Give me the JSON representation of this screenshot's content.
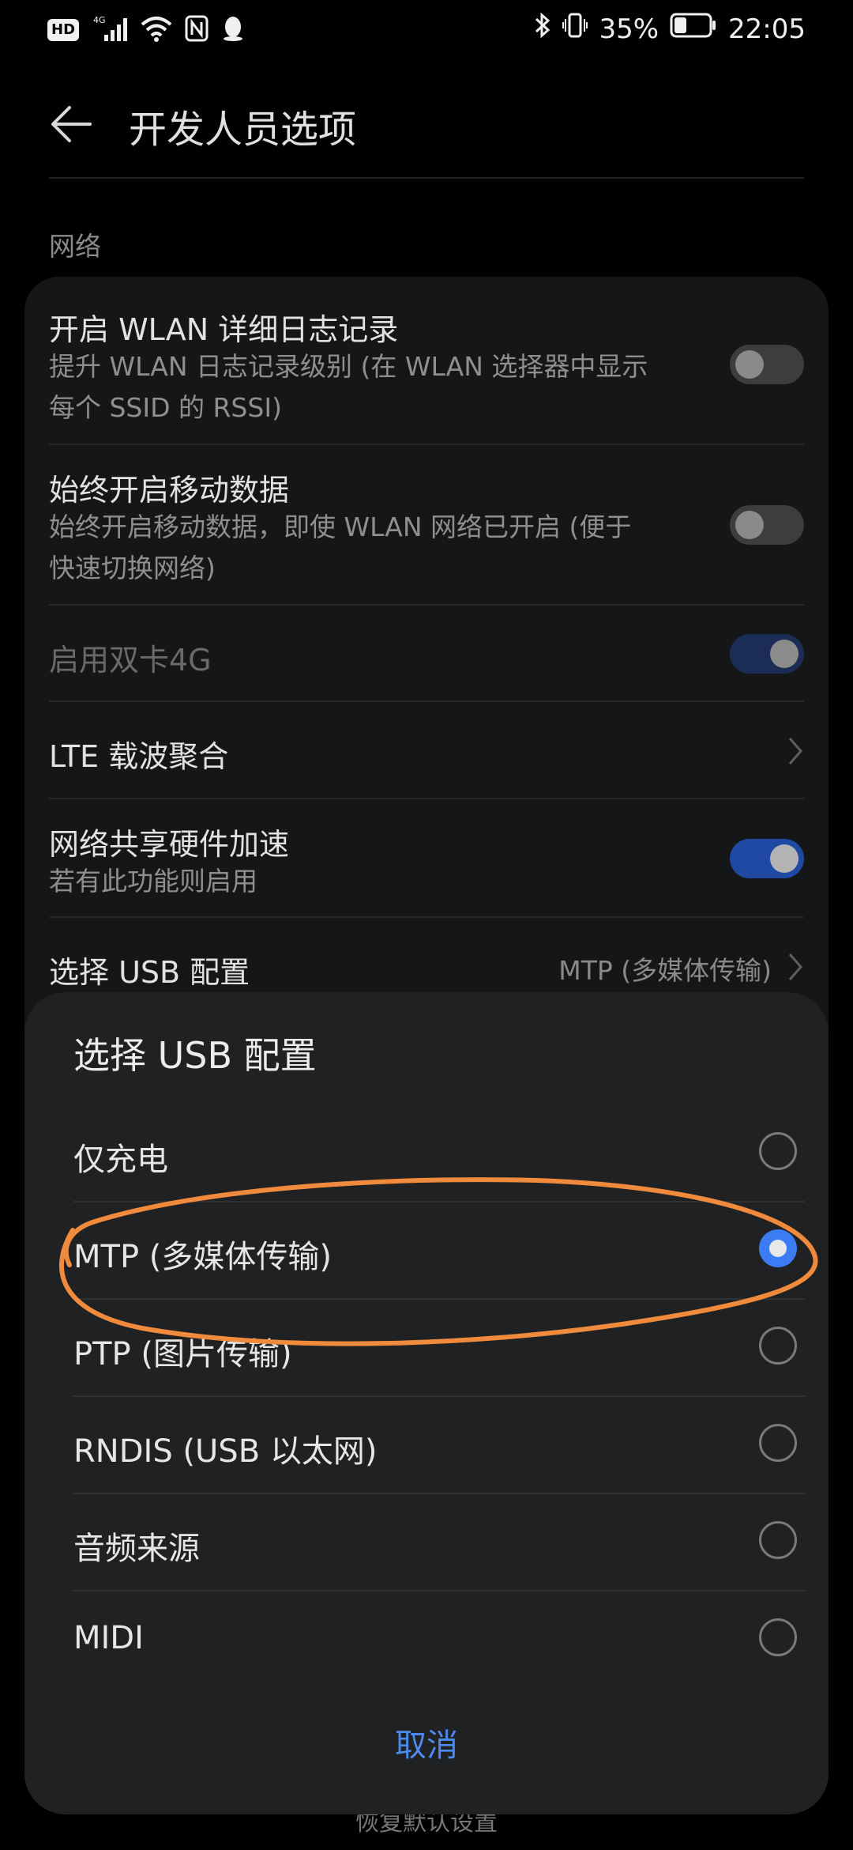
{
  "status_bar": {
    "hd_label": "HD",
    "network_label": "4G",
    "battery_percent": "35%",
    "time": "22:05",
    "icons": [
      "hd-icon",
      "signal-icon",
      "wifi-icon",
      "nfc-icon",
      "qq-icon",
      "bluetooth-icon",
      "vibrate-icon",
      "battery-icon"
    ],
    "battery_level": 0.35
  },
  "header": {
    "title": "开发人员选项",
    "back_icon": "arrow-left-icon"
  },
  "section": {
    "label": "网络"
  },
  "settings": [
    {
      "title": "开启 WLAN 详细日志记录",
      "subtitle_line1": "提升 WLAN 日志记录级别 (在 WLAN 选择器中显示",
      "subtitle_line2": "每个 SSID 的 RSSI)",
      "control": "toggle",
      "on": false
    },
    {
      "title": "始终开启移动数据",
      "subtitle_line1": "始终开启移动数据，即使 WLAN 网络已开启 (便于",
      "subtitle_line2": "快速切换网络)",
      "control": "toggle",
      "on": false
    },
    {
      "title": "启用双卡4G",
      "control": "toggle",
      "on": true,
      "disabled": true
    },
    {
      "title": "LTE 载波聚合",
      "control": "chevron"
    },
    {
      "title": "网络共享硬件加速",
      "subtitle_line1": "若有此功能则启用",
      "control": "toggle",
      "on": true
    },
    {
      "title": "选择 USB 配置",
      "value": "MTP (多媒体传输)",
      "control": "chevron"
    }
  ],
  "background_hint": "恢复默认设置",
  "dialog": {
    "title": "选择 USB 配置",
    "options": [
      {
        "label": "仅充电",
        "selected": false
      },
      {
        "label": "MTP (多媒体传输)",
        "selected": true
      },
      {
        "label": "PTP (图片传输)",
        "selected": false
      },
      {
        "label": "RNDIS (USB 以太网)",
        "selected": false
      },
      {
        "label": "音频来源",
        "selected": false
      },
      {
        "label": "MIDI",
        "selected": false
      }
    ],
    "cancel_label": "取消"
  },
  "colors": {
    "accent": "#3b7cf5",
    "cancel_text": "#4d8af0",
    "annotation_stroke": "#f08a3c"
  }
}
